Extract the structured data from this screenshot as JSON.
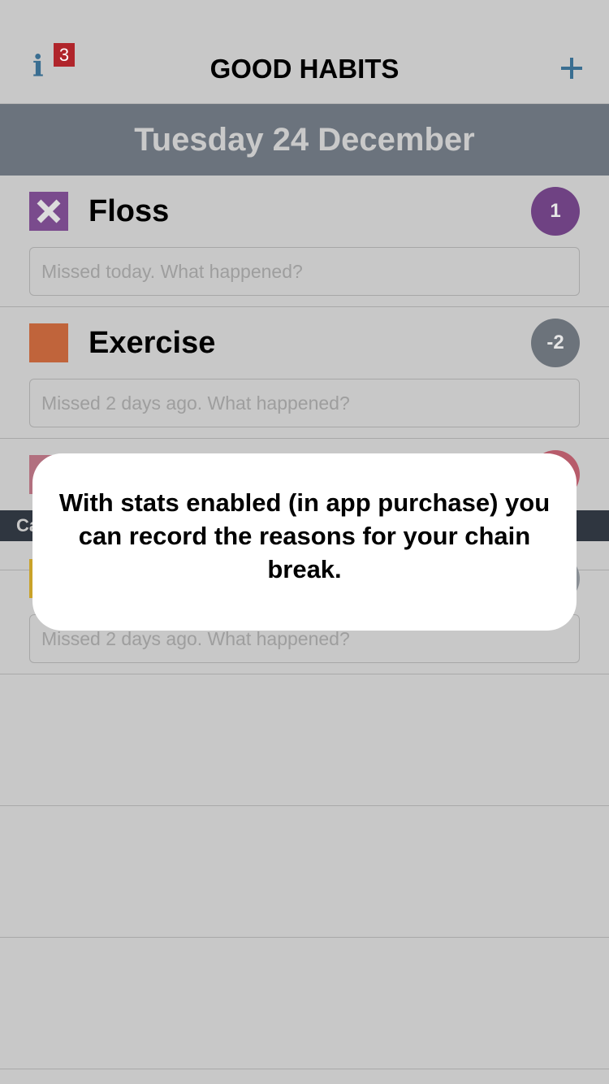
{
  "navbar": {
    "title": "GOOD HABITS",
    "info_badge": "3",
    "info_icon": "info-icon",
    "add_icon": "plus-icon"
  },
  "date_header": "Tuesday 24 December",
  "habits": [
    {
      "name": "Floss",
      "count": "1",
      "status": "missed",
      "swatch_color": "#7a4b8d",
      "count_color": "#6f4283",
      "placeholder": "Missed today. What happened?"
    },
    {
      "name": "Exercise",
      "count": "-2",
      "status": "none",
      "swatch_color": "#c0643b",
      "count_color": "#6c737b",
      "placeholder": "Missed 2 days ago. What happened?"
    },
    {
      "name": "",
      "count": "",
      "swatch_color": "#b2707f",
      "count_color": "#b75c6b",
      "placeholder": ""
    },
    {
      "name": "",
      "count": "",
      "swatch_color": "#c9a22a",
      "count_color": "#8a8f95",
      "placeholder": "Missed 2 days ago. What happened?"
    }
  ],
  "category_partial": "Ca",
  "modal": {
    "message": "With stats enabled (in app purchase) you can record the reasons for your chain break."
  },
  "colors": {
    "background": "#c8c8c8",
    "date_bar": "#6b737d",
    "accent_blue": "#3a6e91",
    "badge_red": "#b0252b"
  }
}
